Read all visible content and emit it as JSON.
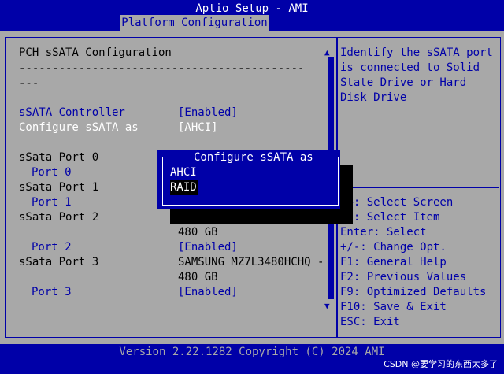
{
  "header": {
    "title": "Aptio Setup - AMI",
    "tab": "Platform Configuration"
  },
  "left": {
    "section_title": "PCH sSATA Configuration",
    "separator_line1": "-------------------------------------------",
    "separator_line2": "---",
    "rows": [
      {
        "label": "sSATA Controller",
        "value": "[Enabled]"
      },
      {
        "label": "Configure sSATA as",
        "value": "[AHCI]"
      }
    ],
    "ports": [
      {
        "label": "sSata Port 0",
        "sub": "Port 0",
        "value": ""
      },
      {
        "label": "sSata Port 1",
        "sub": "Port 1",
        "value": ""
      },
      {
        "label": "sSata Port 2",
        "sub": "Port 2",
        "device_line2": "480 GB",
        "value": "[Enabled]"
      },
      {
        "label": "sSata Port 3",
        "sub": "Port 3",
        "device_line1": "SAMSUNG MZ7L3480HCHQ -",
        "device_line2": "480 GB",
        "value": "[Enabled]"
      }
    ]
  },
  "help": {
    "lines": [
      "Identify the sSATA port",
      "is connected to Solid",
      "State Drive or Hard",
      "Disk Drive"
    ],
    "keys": [
      "→←: Select Screen",
      "↑↓: Select Item",
      "Enter: Select",
      "+/-: Change Opt.",
      "F1: General Help",
      "F2: Previous Values",
      "F9: Optimized Defaults",
      "F10: Save & Exit",
      "ESC: Exit"
    ]
  },
  "popup": {
    "title": "Configure sSATA as",
    "options": [
      "AHCI",
      "RAID"
    ],
    "selected": "RAID"
  },
  "footer": {
    "version": "Version 2.22.1282 Copyright (C) 2024 AMI",
    "watermark": "CSDN @要学习的东西太多了"
  },
  "colors": {
    "bios_blue": "#0000a8",
    "bios_gray": "#a8a8a8",
    "highlight": "#000000",
    "text_white": "#ffffff"
  }
}
